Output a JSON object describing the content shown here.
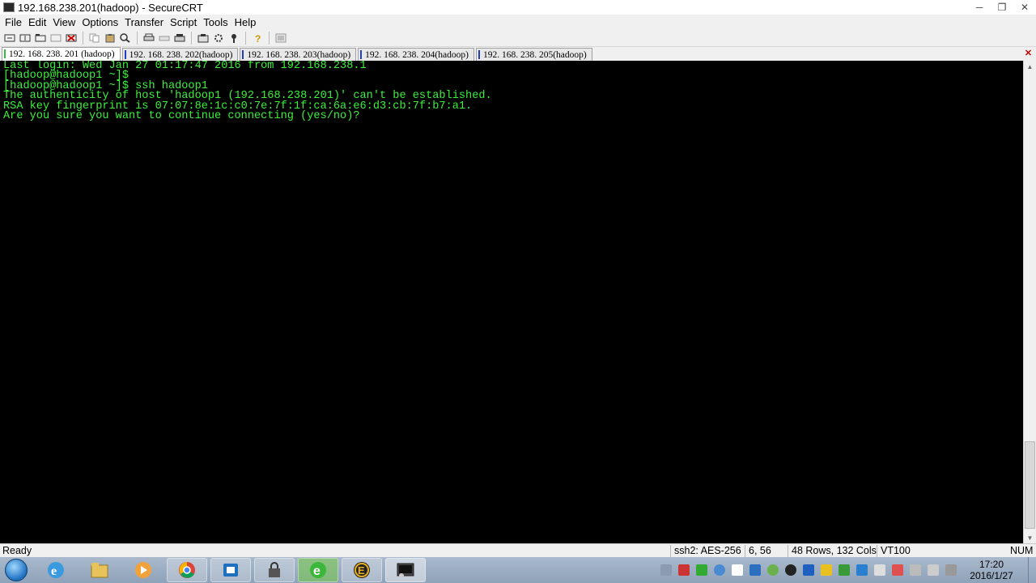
{
  "window": {
    "title": "192.168.238.201(hadoop) - SecureCRT",
    "minimize": "─",
    "restore": "❐",
    "close": "✕"
  },
  "menu": [
    {
      "label": "File"
    },
    {
      "label": "Edit"
    },
    {
      "label": "View"
    },
    {
      "label": "Options"
    },
    {
      "label": "Transfer"
    },
    {
      "label": "Script"
    },
    {
      "label": "Tools"
    },
    {
      "label": "Help"
    }
  ],
  "toolbar": {
    "icons": [
      "connect-icon",
      "quick-connect-icon",
      "connect-tab-icon",
      "reconnect-icon",
      "disconnect-icon",
      "copy-icon",
      "paste-icon",
      "find-icon",
      "print-icon",
      "print-setup-icon",
      "print-selection-icon",
      "session-options-icon",
      "global-options-icon",
      "keymap-icon",
      "help-icon",
      "sftp-icon"
    ]
  },
  "tabs": [
    {
      "label": "192. 168. 238. 201 (hadoop)",
      "active": true
    },
    {
      "label": "192. 168. 238. 202(hadoop)",
      "active": false
    },
    {
      "label": "192. 168. 238. 203(hadoop)",
      "active": false
    },
    {
      "label": "192. 168. 238. 204(hadoop)",
      "active": false
    },
    {
      "label": "192. 168. 238. 205(hadoop)",
      "active": false
    }
  ],
  "tab_close": "✕",
  "terminal": {
    "lines": [
      "Last login: Wed Jan 27 01:17:47 2016 from 192.168.238.1",
      "[hadoop@hadoop1 ~]$",
      "[hadoop@hadoop1 ~]$ ssh hadoop1",
      "The authenticity of host 'hadoop1 (192.168.238.201)' can't be established.",
      "RSA key fingerprint is 07:07:8e:1c:c0:7e:7f:1f:ca:6a:e6:d3:cb:7f:b7:a1.",
      "Are you sure you want to continue connecting (yes/no)?"
    ],
    "text_color": "#3cf03c",
    "background": "#000000"
  },
  "status": {
    "ready": "Ready",
    "cipher": "ssh2: AES-256",
    "cursor": "6,  56",
    "size": "48 Rows, 132 Cols",
    "emulation": "VT100",
    "numlock": "NUM"
  },
  "taskbar": {
    "apps": [
      "ie-icon",
      "explorer-icon",
      "media-player-icon",
      "chrome-icon",
      "outlook-icon",
      "lock-app-icon",
      "green-e-icon",
      "e-app-icon",
      "securecrt-icon"
    ],
    "clock_time": "17:20",
    "clock_date": "2016/1/27"
  }
}
